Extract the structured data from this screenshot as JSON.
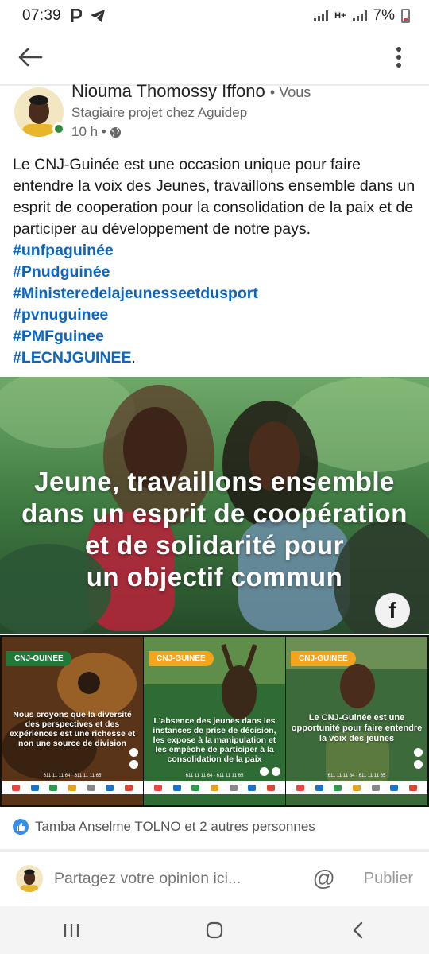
{
  "status_bar": {
    "time": "07:39",
    "battery": "7%",
    "network": "H+",
    "notification_icons": [
      "parking-icon",
      "telegram-icon"
    ]
  },
  "app_bar": {
    "back_icon": "arrow-left-icon",
    "menu_icon": "more-vert-icon"
  },
  "post": {
    "author": {
      "name": "Niouma Thomossy Iffono",
      "relation": "• Vous",
      "headline": "Stagiaire projet chez Aguidep",
      "time": "10 h •",
      "visibility_icon": "globe-icon"
    },
    "text": "Le CNJ-Guinée est une occasion unique pour faire entendre la voix des Jeunes, travaillons ensemble dans un esprit de cooperation pour la consolidation de la paix et de participer au développement de notre pays.",
    "hashtags": [
      "#unfpaguinée",
      "#Pnudguinée",
      "#Ministeredelajeunesseetdusport",
      "#pvnuguinee",
      "#PMFguinee"
    ],
    "last_hashtag": "#LECNJGUINEE",
    "last_punct": ".",
    "main_image": {
      "lines": [
        "Jeune,  travaillons  ensemble",
        "dans  un  esprit  de  coopération",
        "et  de  solidarité  pour",
        "un  objectif  commun"
      ],
      "badge": "f"
    },
    "thumbnails": [
      {
        "tag": "CNJ-GUINEE",
        "text": "Nous croyons que la diversité des perspectives et des expériences est une richesse et non une source de division",
        "contacts": "611 11 11 64 · 611 11 11 65",
        "accent": "#1f7a3a"
      },
      {
        "tag": "CNJ-GUINEE",
        "text": "L'absence des jeunes dans les instances de prise de décision, les expose à la manipulation et les empêche de participer à la consolidation de la paix",
        "contacts": "611 11 11 64 · 611 11 11 65",
        "accent": "#f4a51c"
      },
      {
        "tag": "CNJ-GUINEE",
        "text": "Le CNJ-Guinée est une opportunité pour faire entendre la voix des jeunes",
        "contacts": "611 11 11 64 · 611 11 11 65",
        "accent": "#f4a51c"
      }
    ],
    "reactions": {
      "icon": "like-icon",
      "text": "Tamba Anselme TOLNO et 2 autres personnes"
    }
  },
  "comment_bar": {
    "placeholder": "Partagez votre opinion ici...",
    "mention_icon": "at-sign-icon",
    "publish_label": "Publier"
  },
  "nav_bar": {
    "items": [
      "recent-apps-icon",
      "home-icon",
      "back-icon"
    ]
  },
  "colors": {
    "link": "#0a66c2",
    "online": "#2e8b3d",
    "like": "#378fe9"
  }
}
